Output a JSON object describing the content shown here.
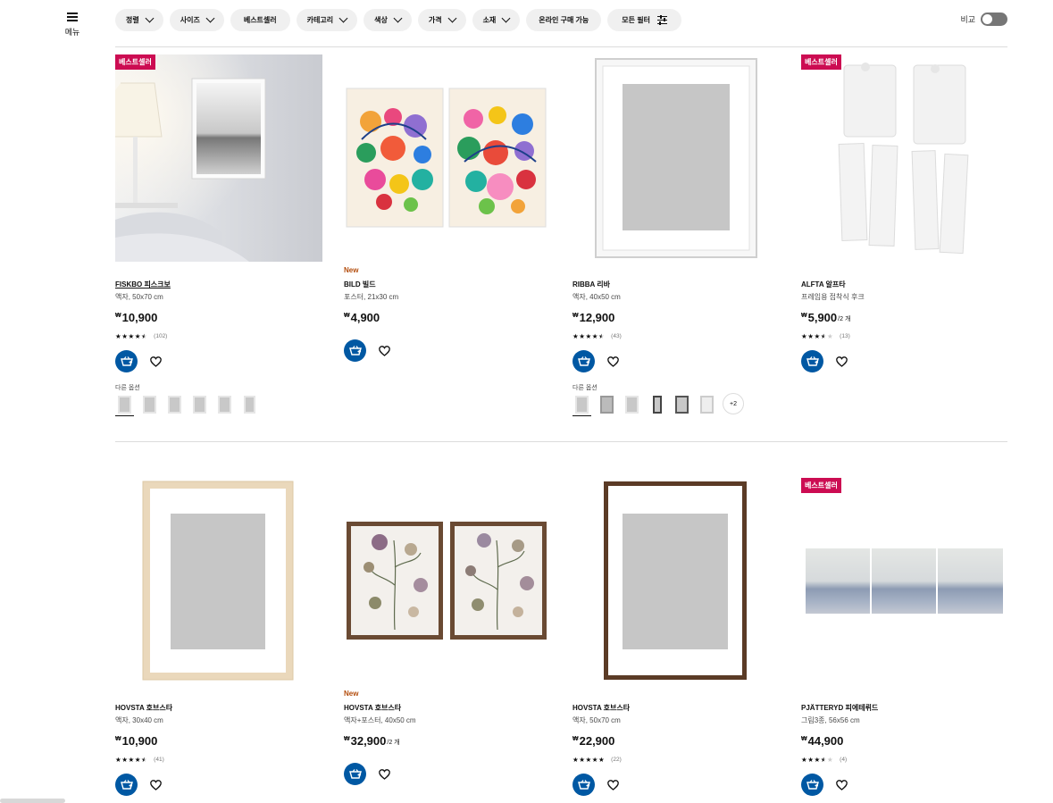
{
  "menu": {
    "label": "메뉴",
    "icon": "hamburger-icon"
  },
  "filters": [
    {
      "label": "정렬",
      "icon": "chevron-down-icon"
    },
    {
      "label": "사이즈",
      "icon": "chevron-down-icon"
    },
    {
      "label": "베스트셀러",
      "icon": ""
    },
    {
      "label": "카테고리",
      "icon": "chevron-down-icon"
    },
    {
      "label": "색상",
      "icon": "chevron-down-icon"
    },
    {
      "label": "가격",
      "icon": "chevron-down-icon"
    },
    {
      "label": "소재",
      "icon": "chevron-down-icon"
    },
    {
      "label": "온라인 구매 가능",
      "icon": ""
    },
    {
      "label": "모든 필터",
      "icon": "sliders-icon"
    }
  ],
  "compare": {
    "label": "비교",
    "enabled": false
  },
  "colors": {
    "accent": "#0058a3",
    "badge": "#cc0c52",
    "new": "#b34d0d"
  },
  "products": [
    {
      "badge": "베스트셀러",
      "new": "",
      "name": "FISKBO 피스크보",
      "desc": "액자, 50x70 cm",
      "currency": "₩",
      "price": "10,900",
      "unit": "",
      "rating": 4.5,
      "reviews": "(102)",
      "variants_label": "다른 옵션",
      "variant_count": 6,
      "more": ""
    },
    {
      "badge": "",
      "new": "New",
      "name": "BILD 빌드",
      "desc": "포스터, 21x30 cm",
      "currency": "₩",
      "price": "4,900",
      "unit": "",
      "rating": null,
      "reviews": "",
      "variants_label": "",
      "variant_count": 0,
      "more": ""
    },
    {
      "badge": "",
      "new": "",
      "name": "RIBBA 리바",
      "desc": "액자, 40x50 cm",
      "currency": "₩",
      "price": "12,900",
      "unit": "",
      "rating": 4.5,
      "reviews": "(43)",
      "variants_label": "다른 옵션",
      "variant_count": 6,
      "more": "+2"
    },
    {
      "badge": "베스트셀러",
      "new": "",
      "name": "ALFTA 알프타",
      "desc": "프레임용 접착식 후크",
      "currency": "₩",
      "price": "5,900",
      "unit": "/2 개",
      "rating": 3.5,
      "reviews": "(13)",
      "variants_label": "",
      "variant_count": 0,
      "more": ""
    },
    {
      "badge": "",
      "new": "",
      "name": "HOVSTA 호브스타",
      "desc": "액자, 30x40 cm",
      "currency": "₩",
      "price": "10,900",
      "unit": "",
      "rating": 4.5,
      "reviews": "(41)",
      "variants_label": "",
      "variant_count": 0,
      "more": ""
    },
    {
      "badge": "",
      "new": "New",
      "name": "HOVSTA 호브스타",
      "desc": "액자+포스터, 40x50 cm",
      "currency": "₩",
      "price": "32,900",
      "unit": "/2 개",
      "rating": null,
      "reviews": "",
      "variants_label": "",
      "variant_count": 0,
      "more": ""
    },
    {
      "badge": "",
      "new": "",
      "name": "HOVSTA 호브스타",
      "desc": "액자, 50x70 cm",
      "currency": "₩",
      "price": "22,900",
      "unit": "",
      "rating": 5,
      "reviews": "(22)",
      "variants_label": "",
      "variant_count": 0,
      "more": ""
    },
    {
      "badge": "베스트셀러",
      "new": "",
      "name": "PJÄTTERYD 피에테뤼드",
      "desc": "그림3종, 56x56 cm",
      "currency": "₩",
      "price": "44,900",
      "unit": "",
      "rating": 3.5,
      "reviews": "(4)",
      "variants_label": "",
      "variant_count": 0,
      "more": ""
    }
  ]
}
